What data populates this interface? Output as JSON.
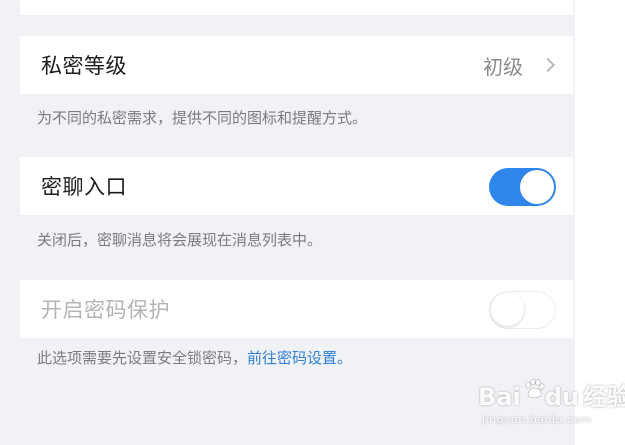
{
  "privacy_level": {
    "label": "私密等级",
    "value": "初级",
    "hint": "为不同的私密需求，提供不同的图标和提醒方式。"
  },
  "secret_chat_entry": {
    "label": "密聊入口",
    "enabled": true,
    "hint": "关闭后，密聊消息将会展现在消息列表中。"
  },
  "password_protection": {
    "label": "开启密码保护",
    "enabled": false,
    "hint_prefix": "此选项需要先设置安全锁密码，",
    "hint_link": "前往密码设置。"
  },
  "watermark": {
    "brand_left": "Bai",
    "brand_right": "du",
    "brand_cn": "经验",
    "url": "jingyan.baidu.com"
  },
  "colors": {
    "accent": "#2f86ea",
    "link": "#2f7fd9",
    "background": "#f1f2f6"
  }
}
